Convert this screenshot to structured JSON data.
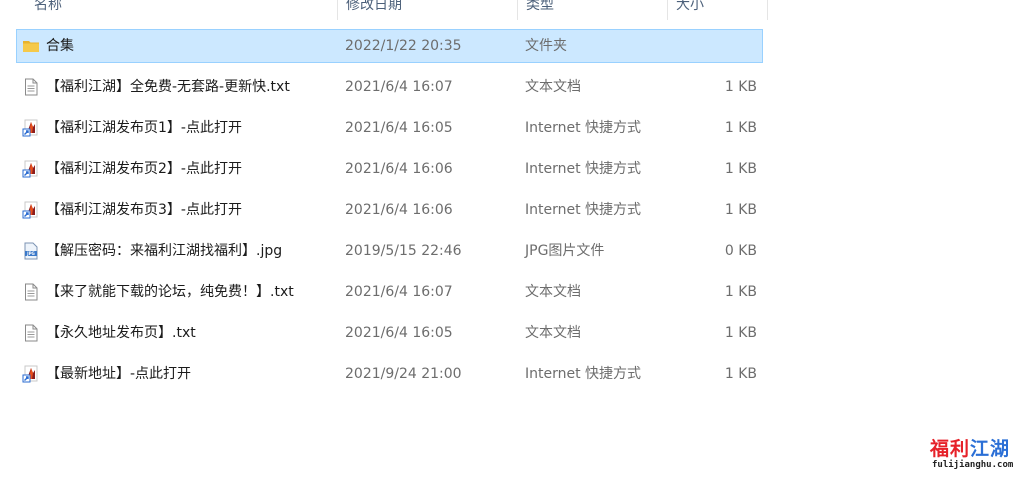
{
  "columns": {
    "name": "名称",
    "date": "修改日期",
    "type": "类型",
    "size": "大小"
  },
  "files": [
    {
      "name": "合集",
      "date": "2022/1/22 20:35",
      "type": "文件夹",
      "size": "",
      "icon": "folder-icon",
      "selected": true
    },
    {
      "name": "【福利江湖】全免费-无套路-更新快.txt",
      "date": "2021/6/4 16:07",
      "type": "文本文档",
      "size": "1 KB",
      "icon": "text-file-icon"
    },
    {
      "name": "【福利江湖发布页1】-点此打开",
      "date": "2021/6/4 16:05",
      "type": "Internet 快捷方式",
      "size": "1 KB",
      "icon": "internet-shortcut-icon"
    },
    {
      "name": "【福利江湖发布页2】-点此打开",
      "date": "2021/6/4 16:06",
      "type": "Internet 快捷方式",
      "size": "1 KB",
      "icon": "internet-shortcut-icon"
    },
    {
      "name": "【福利江湖发布页3】-点此打开",
      "date": "2021/6/4 16:06",
      "type": "Internet 快捷方式",
      "size": "1 KB",
      "icon": "internet-shortcut-icon"
    },
    {
      "name": "【解压密码：来福利江湖找福利】.jpg",
      "date": "2019/5/15 22:46",
      "type": "JPG图片文件",
      "size": "0 KB",
      "icon": "jpg-file-icon"
    },
    {
      "name": "【来了就能下载的论坛，纯免费！】.txt",
      "date": "2021/6/4 16:07",
      "type": "文本文档",
      "size": "1 KB",
      "icon": "text-file-icon"
    },
    {
      "name": "【永久地址发布页】.txt",
      "date": "2021/6/4 16:05",
      "type": "文本文档",
      "size": "1 KB",
      "icon": "text-file-icon"
    },
    {
      "name": "【最新地址】-点此打开",
      "date": "2021/9/24 21:00",
      "type": "Internet 快捷方式",
      "size": "1 KB",
      "icon": "internet-shortcut-icon"
    }
  ],
  "watermark": {
    "title_part1": "福利",
    "title_part2": "江湖",
    "url": "fulijianghu.com"
  },
  "colors": {
    "selection_bg": "#cce8ff",
    "selection_border": "#99d1ff",
    "folder": "#f3c244",
    "watermark_red": "#e62129",
    "watermark_blue": "#2b6fd6"
  }
}
